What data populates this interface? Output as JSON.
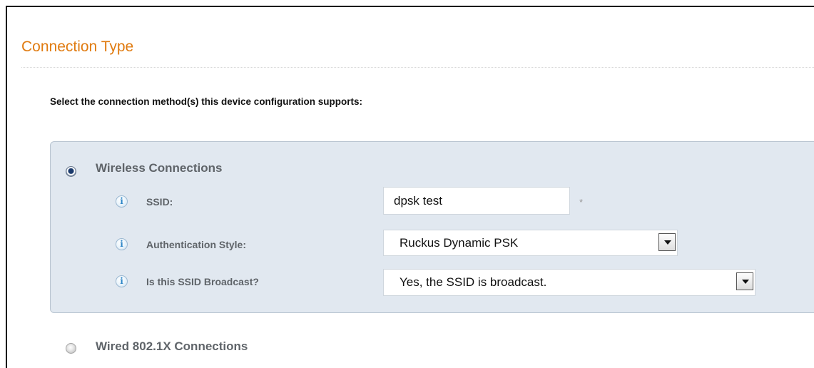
{
  "section": {
    "title": "Connection Type",
    "prompt": "Select the connection method(s) this device configuration supports:"
  },
  "wireless": {
    "label": "Wireless Connections",
    "selected": true,
    "fields": {
      "ssid": {
        "label": "SSID:",
        "value": "dpsk test",
        "required_marker": "*"
      },
      "auth_style": {
        "label": "Authentication Style:",
        "value": "Ruckus Dynamic PSK"
      },
      "broadcast": {
        "label": "Is this SSID Broadcast?",
        "value": "Yes, the SSID is broadcast."
      }
    },
    "info_icon_glyph": "i",
    "panel_color": "#e1e8f0"
  },
  "wired": {
    "label": "Wired 802.1X Connections",
    "selected": false
  },
  "colors": {
    "title": "#e07b10",
    "label": "#5f6469",
    "info_icon": "#2e86c7"
  },
  "icons": [
    "info-icon",
    "radio-checked",
    "radio-unchecked",
    "dropdown-arrow-icon"
  ]
}
